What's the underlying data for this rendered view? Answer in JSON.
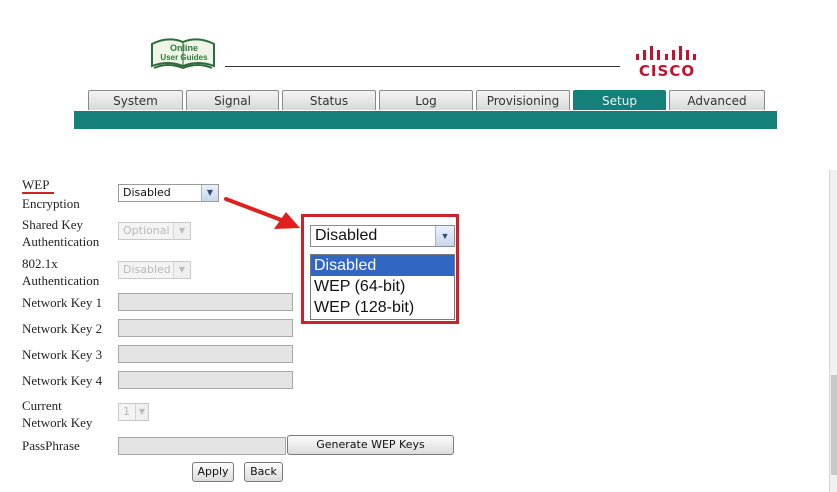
{
  "header": {
    "guide_badge_line1": "Online",
    "guide_badge_line2": "User Guides",
    "brand": "CISCO"
  },
  "tabs": [
    {
      "label": "System"
    },
    {
      "label": "Signal"
    },
    {
      "label": "Status"
    },
    {
      "label": "Log"
    },
    {
      "label": "Provisioning"
    },
    {
      "label": "Setup",
      "active": true
    },
    {
      "label": "Advanced"
    }
  ],
  "form": {
    "wep": {
      "label_top": "WEP",
      "label_bottom": "Encryption",
      "value": "Disabled"
    },
    "shared_key": {
      "label_top": "Shared Key",
      "label_bottom": "Authentication",
      "value": "Optional"
    },
    "dot1x": {
      "label_top": "802.1x",
      "label_bottom": "Authentication",
      "value": "Disabled"
    },
    "key1": {
      "label": "Network Key 1",
      "value": ""
    },
    "key2": {
      "label": "Network Key 2",
      "value": ""
    },
    "key3": {
      "label": "Network Key 3",
      "value": ""
    },
    "key4": {
      "label": "Network Key 4",
      "value": ""
    },
    "current_key": {
      "label_top": "Current",
      "label_bottom": "Network Key",
      "value": "1"
    },
    "passphrase": {
      "label": "PassPhrase",
      "value": ""
    },
    "generate_label": "Generate WEP Keys",
    "apply_label": "Apply",
    "back_label": "Back"
  },
  "callout": {
    "selected": "Disabled",
    "options": [
      "Disabled",
      "WEP (64-bit)",
      "WEP (128-bit)"
    ],
    "highlight_color": "#3166c3",
    "border_color": "#d0202a"
  },
  "colors": {
    "teal": "#148079",
    "arrow_red": "#e0201f"
  }
}
